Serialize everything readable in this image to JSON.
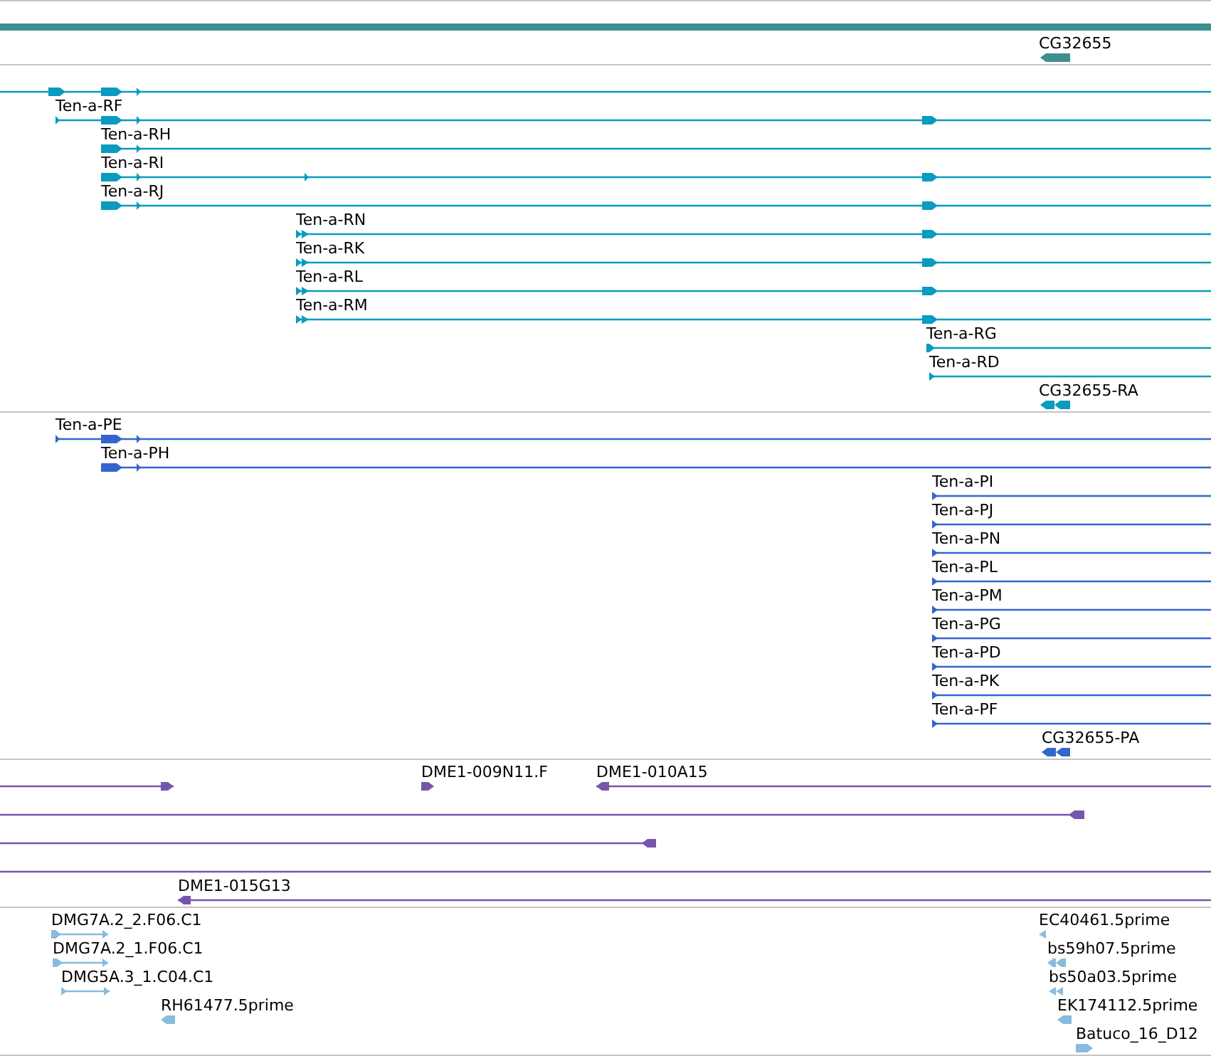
{
  "tracks": [
    {
      "color": "#3f8f91",
      "features": [
        {
          "kind": "plain"
        },
        {
          "label": "CG32655",
          "kind": "reverse"
        }
      ]
    },
    {
      "color": "#0a9bbf",
      "features": [
        {
          "kind": "forward"
        },
        {
          "label": "Ten-a-RF",
          "kind": "forward"
        },
        {
          "label": "Ten-a-RH",
          "kind": "forward"
        },
        {
          "label": "Ten-a-RI",
          "kind": "forward"
        },
        {
          "label": "Ten-a-RJ",
          "kind": "forward"
        },
        {
          "label": "Ten-a-RN",
          "kind": "forward"
        },
        {
          "label": "Ten-a-RK",
          "kind": "forward"
        },
        {
          "label": "Ten-a-RL",
          "kind": "forward"
        },
        {
          "label": "Ten-a-RM",
          "kind": "forward"
        },
        {
          "label": "Ten-a-RG",
          "kind": "forward"
        },
        {
          "label": "Ten-a-RD",
          "kind": "forward"
        },
        {
          "label": "CG32655-RA",
          "kind": "reverse"
        }
      ]
    },
    {
      "color": "#3366cc",
      "features": [
        {
          "label": "Ten-a-PE",
          "kind": "forward"
        },
        {
          "label": "Ten-a-PH",
          "kind": "forward"
        },
        {
          "label": "Ten-a-PI",
          "kind": "forward"
        },
        {
          "label": "Ten-a-PJ",
          "kind": "forward"
        },
        {
          "label": "Ten-a-PN",
          "kind": "forward"
        },
        {
          "label": "Ten-a-PL",
          "kind": "forward"
        },
        {
          "label": "Ten-a-PM",
          "kind": "forward"
        },
        {
          "label": "Ten-a-PG",
          "kind": "forward"
        },
        {
          "label": "Ten-a-PD",
          "kind": "forward"
        },
        {
          "label": "Ten-a-PK",
          "kind": "forward"
        },
        {
          "label": "Ten-a-PF",
          "kind": "forward"
        },
        {
          "label": "CG32655-PA",
          "kind": "reverse"
        }
      ]
    },
    {
      "color": "#7755aa",
      "features": [
        {
          "kind": "forward"
        },
        {
          "label": "DME1-009N11.F",
          "kind": "forward"
        },
        {
          "label": "DME1-010A15",
          "kind": "reverse"
        },
        {
          "kind": "reverse"
        },
        {
          "kind": "reverse"
        },
        {
          "kind": "plain"
        },
        {
          "label": "DME1-015G13",
          "kind": "reverse"
        }
      ]
    },
    {
      "color": "#88bbdd",
      "features": [
        {
          "label": "DMG7A.2_2.F06.C1",
          "kind": "forward"
        },
        {
          "label": "DMG7A.2_1.F06.C1",
          "kind": "forward"
        },
        {
          "label": "DMG5A.3_1.C04.C1",
          "kind": "forward"
        },
        {
          "label": "RH61477.5prime",
          "kind": "reverse"
        },
        {
          "label": "EC40461.5prime",
          "kind": "reverse"
        },
        {
          "label": "bs59h07.5prime",
          "kind": "reverse"
        },
        {
          "label": "bs50a03.5prime",
          "kind": "reverse"
        },
        {
          "label": "EK174112.5prime",
          "kind": "reverse"
        },
        {
          "label": "Batuco_16_D12",
          "kind": "forward"
        }
      ]
    }
  ]
}
